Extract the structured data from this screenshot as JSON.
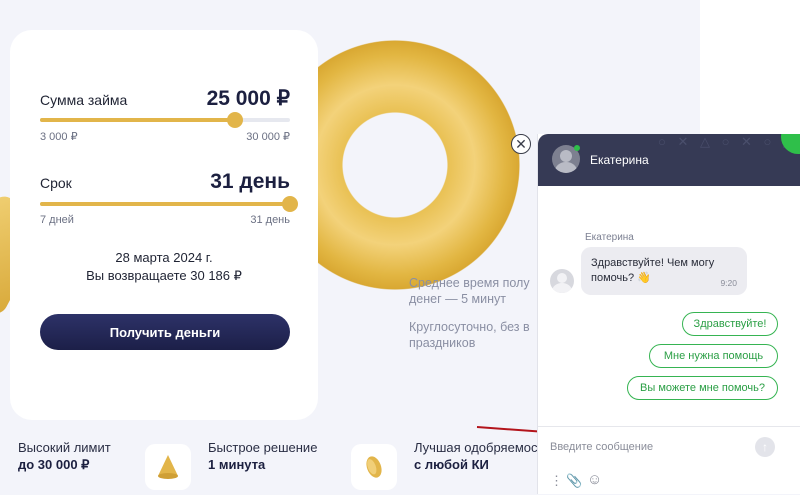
{
  "calculator": {
    "amount_label": "Сумма займа",
    "amount_value": "25 000 ₽",
    "amount_min": "3 000 ₽",
    "amount_max": "30 000 ₽",
    "amount_fraction": 0.78,
    "term_label": "Срок",
    "term_value": "31 день",
    "term_min": "7 дней",
    "term_max": "31 день",
    "term_fraction": 1.0,
    "return_date": "28 марта 2024 г.",
    "return_amount": "Вы возвращаете 30 186 ₽",
    "cta_label": "Получить деньги",
    "accent_color": "#e2b54a"
  },
  "info": {
    "line1a": "Среднее время полу",
    "line1b": "денег — 5 минут",
    "line2a": "Круглосуточно, без в",
    "line2b": "праздников"
  },
  "features": [
    {
      "title": "Высокий лимит",
      "value": "до 30 000 ₽",
      "icon": "none"
    },
    {
      "title": "Быстрое решение",
      "value": "1 минута",
      "icon": "cone-icon"
    },
    {
      "title": "Лучшая одобряемос",
      "value": "с любой КИ",
      "icon": "coin-icon"
    }
  ],
  "chat": {
    "agent_name": "Екатерина",
    "header_color": "#363a55",
    "online_color": "#2fbf4a",
    "message_author": "Екатерина",
    "message_text": "Здравствуйте! Чем могу помочь? 👋",
    "message_time": "9:20",
    "quick_replies": [
      "Здравствуйте!",
      "Мне нужна помощь",
      "Вы можете мне помочь?"
    ],
    "input_placeholder": "Введите сообщение",
    "close_symbol": "✕",
    "send_symbol": "↑",
    "tools": {
      "menu": "⋮",
      "attach": "📎",
      "emoji": "☺"
    }
  }
}
